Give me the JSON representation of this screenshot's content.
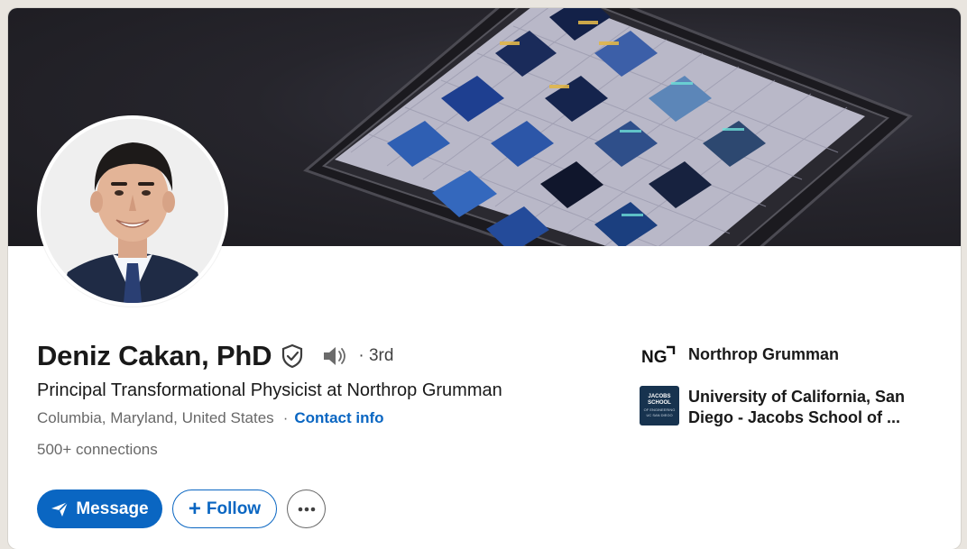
{
  "profile": {
    "name": "Deniz Cakan, PhD",
    "degree": "· 3rd",
    "headline": "Principal Transformational Physicist at Northrop Grumman",
    "location": "Columbia, Maryland, United States",
    "separator": "·",
    "contact_label": "Contact info",
    "connections": "500+ connections"
  },
  "actions": {
    "message_label": "Message",
    "follow_label": "Follow"
  },
  "experience": {
    "company": "Northrop Grumman",
    "company_logo_text": "NG"
  },
  "education": {
    "school": "University of California, San Diego - Jacobs School of ...",
    "logo_line1": "JACOBS",
    "logo_line2": "SCHOOL",
    "logo_line3": "OF ENGINEERING",
    "logo_line4": "UC SAN DIEGO"
  },
  "colors": {
    "accent": "#0a66c2",
    "school_logo_bg": "#17334f"
  },
  "icons": {
    "verified": "shield-check-icon",
    "pronunciation": "speaker-icon",
    "message": "paper-plane-icon",
    "follow": "plus-icon",
    "more": "ellipsis-icon"
  }
}
